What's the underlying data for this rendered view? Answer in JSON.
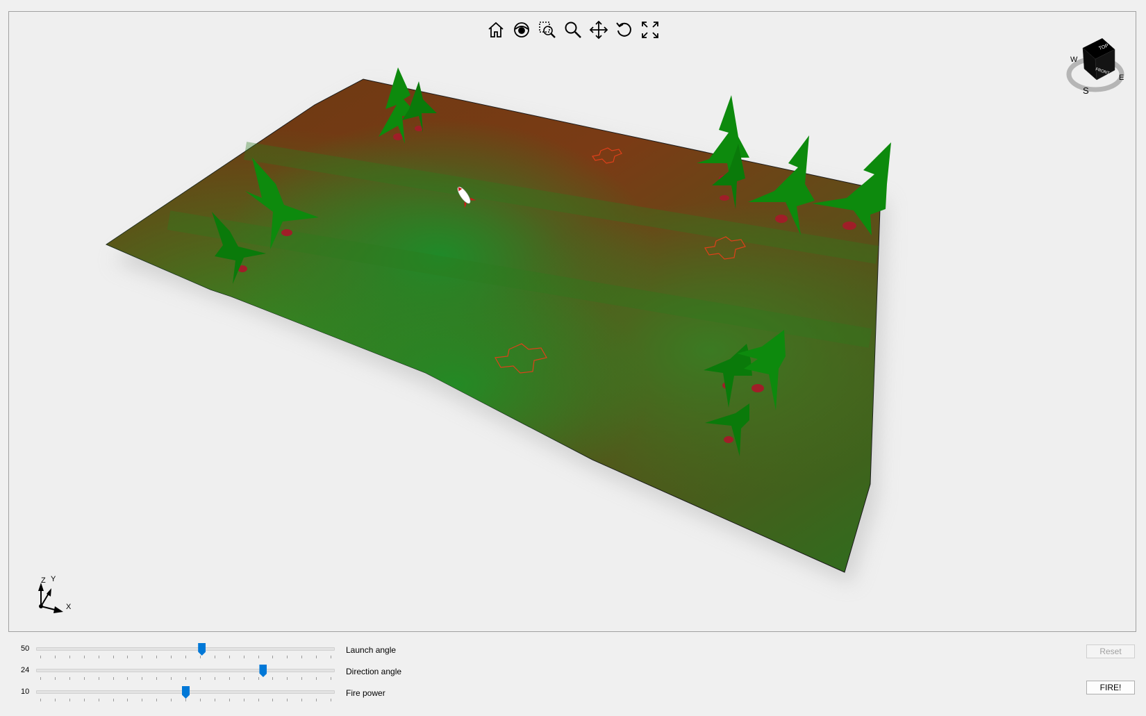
{
  "viewport": {
    "toolbar": [
      {
        "name": "home-icon"
      },
      {
        "name": "eye-icon"
      },
      {
        "name": "zoom-window-icon"
      },
      {
        "name": "zoom-icon"
      },
      {
        "name": "pan-icon"
      },
      {
        "name": "rotate-icon"
      },
      {
        "name": "fit-to-screen-icon"
      }
    ],
    "viewcube": {
      "top_label": "TOP",
      "front_label": "FRONT",
      "compass_w": "W",
      "compass_s": "S",
      "compass_e": "E"
    },
    "axes": {
      "x_label": "X",
      "y_label": "Y",
      "z_label": "Z"
    },
    "colors": {
      "terrain_green": "#2e8b22",
      "terrain_brown": "#7a3a14",
      "tree_green": "#0d8a0d",
      "trunk_red": "#a01e28",
      "target_red": "#e0401a"
    }
  },
  "controls": {
    "sliders": [
      {
        "value": "50",
        "label": "Launch angle",
        "min": 0,
        "max": 90,
        "current": 50
      },
      {
        "value": "24",
        "label": "Direction angle",
        "min": -45,
        "max": 45,
        "current": 24
      },
      {
        "value": "10",
        "label": "Fire power",
        "min": 0,
        "max": 20,
        "current": 10
      }
    ],
    "reset_label": "Reset",
    "fire_label": "FIRE!"
  }
}
